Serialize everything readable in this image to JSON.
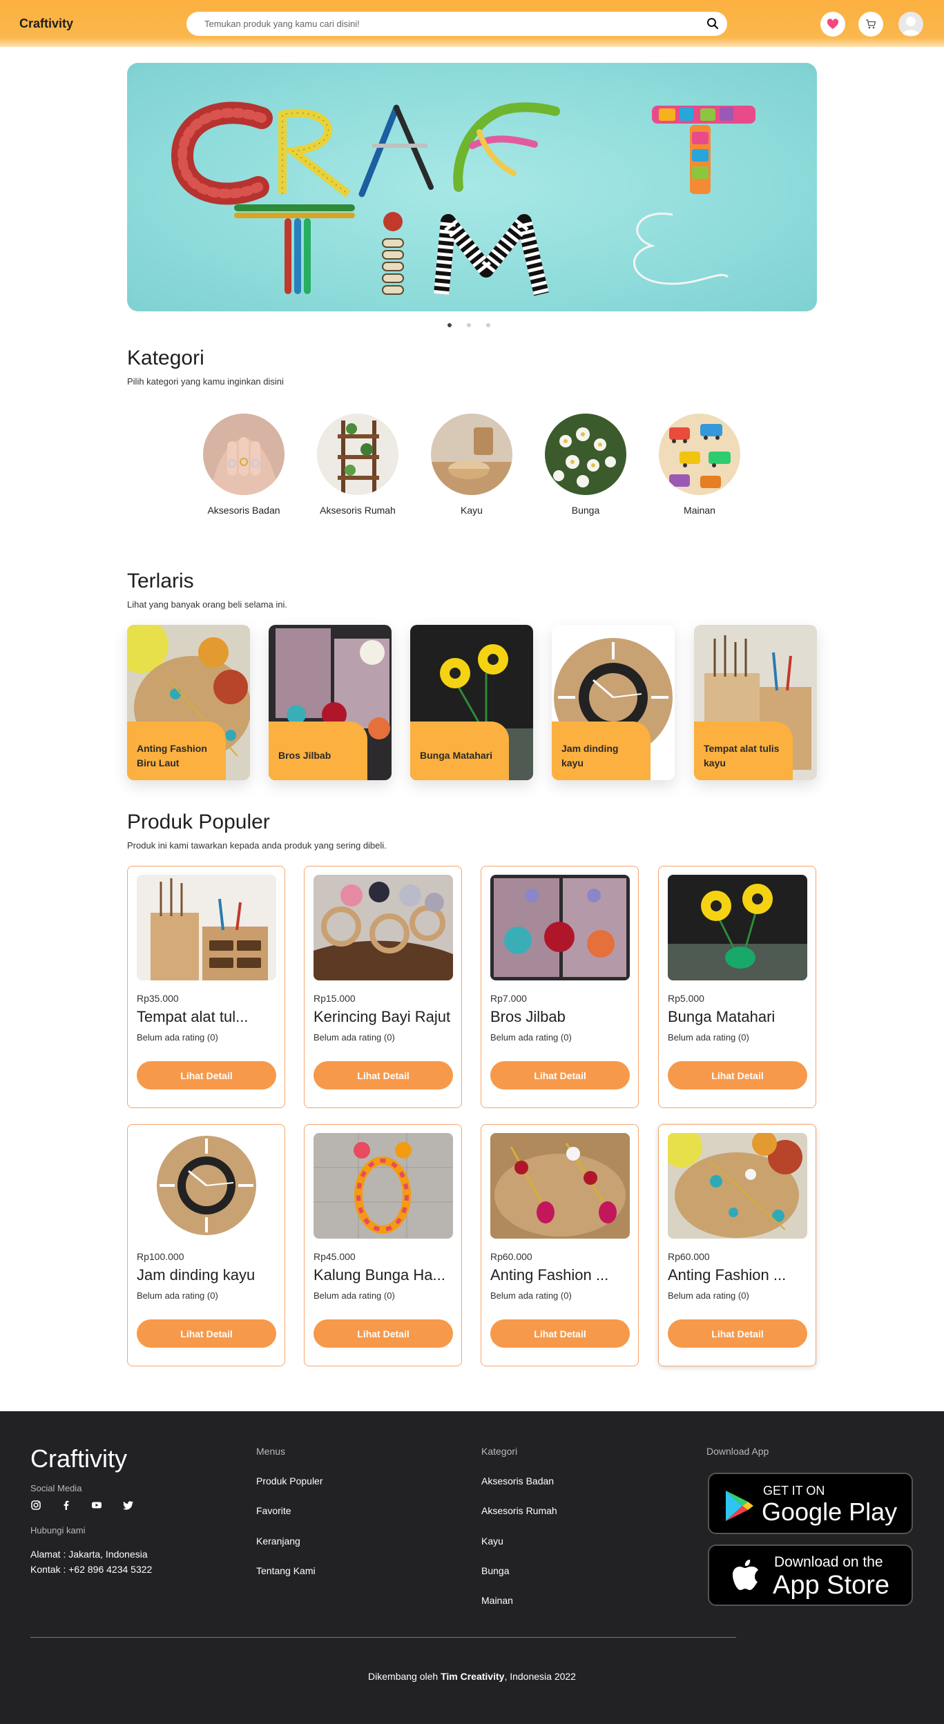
{
  "header": {
    "brand": "Craftivity",
    "search_placeholder": "Temukan produk yang kamu cari disini!"
  },
  "hero": {
    "image_text": "CRAFT TIME",
    "slides": 3,
    "active_slide": 1
  },
  "kategori": {
    "title": "Kategori",
    "subtitle": "Pilih kategori yang kamu inginkan disini",
    "items": [
      {
        "label": "Aksesoris Badan"
      },
      {
        "label": "Aksesoris Rumah"
      },
      {
        "label": "Kayu"
      },
      {
        "label": "Bunga"
      },
      {
        "label": "Mainan"
      }
    ]
  },
  "terlaris": {
    "title": "Terlaris",
    "subtitle": "Lihat yang banyak orang beli selama ini.",
    "items": [
      {
        "label": "Anting Fashion Biru Laut"
      },
      {
        "label": "Bros Jilbab"
      },
      {
        "label": "Bunga Matahari"
      },
      {
        "label": "Jam dinding kayu"
      },
      {
        "label": "Tempat alat tulis kayu"
      }
    ]
  },
  "populer": {
    "title": "Produk Populer",
    "subtitle": "Produk ini kami tawarkan kepada anda produk yang sering dibeli.",
    "button_label": "Lihat Detail",
    "products": [
      {
        "price": "Rp35.000",
        "name": "Tempat alat tul...",
        "rating": "Belum ada rating  (0)"
      },
      {
        "price": "Rp15.000",
        "name": "Kerincing Bayi Rajut",
        "rating": "Belum ada rating  (0)"
      },
      {
        "price": "Rp7.000",
        "name": "Bros Jilbab",
        "rating": "Belum ada rating  (0)"
      },
      {
        "price": "Rp5.000",
        "name": "Bunga Matahari",
        "rating": "Belum ada rating  (0)"
      },
      {
        "price": "Rp100.000",
        "name": "Jam dinding kayu",
        "rating": "Belum ada rating  (0)"
      },
      {
        "price": "Rp45.000",
        "name": "Kalung Bunga Ha...",
        "rating": "Belum ada rating  (0)"
      },
      {
        "price": "Rp60.000",
        "name": "Anting Fashion ...",
        "rating": "Belum ada rating  (0)"
      },
      {
        "price": "Rp60.000",
        "name": "Anting Fashion ...",
        "rating": "Belum ada rating  (0)"
      }
    ]
  },
  "footer": {
    "brand": "Craftivity",
    "social_label": "Social Media",
    "contact_label": "Hubungi kami",
    "address": "Alamat : Jakarta, Indonesia",
    "phone": "Kontak : +62 896 4234 5322",
    "menus_title": "Menus",
    "menus": [
      "Produk Populer",
      "Favorite",
      "Keranjang",
      "Tentang Kami"
    ],
    "kategori_title": "Kategori",
    "kategori": [
      "Aksesoris Badan",
      "Aksesoris Rumah",
      "Kayu",
      "Bunga",
      "Mainan"
    ],
    "download_title": "Download App",
    "google_small": "GET IT ON",
    "google_big": "Google Play",
    "apple_small": "Download on the",
    "apple_big": "App Store",
    "credit_prefix": "Dikembang oleh ",
    "credit_team": "Tim Creativity",
    "credit_suffix": ", Indonesia 2022"
  },
  "colors": {
    "header": "#fbb03f",
    "accent": "#f7994a",
    "card_border": "#f7a46a",
    "footer": "#222224"
  }
}
